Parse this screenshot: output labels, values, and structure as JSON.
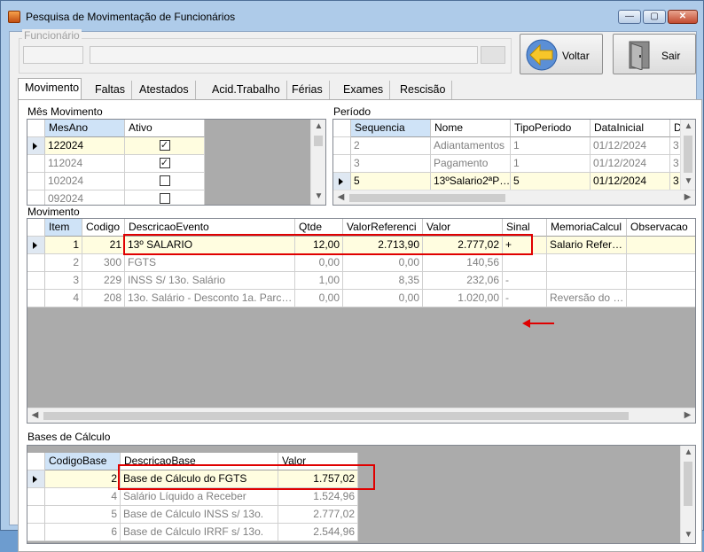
{
  "window": {
    "title": "Pesquisa de Movimentação de Funcionários",
    "minimize": "—",
    "maximize": "▢",
    "close": "✕"
  },
  "funcionario": {
    "legend": "Funcionário"
  },
  "buttons": {
    "voltar": "Voltar",
    "sair": "Sair"
  },
  "tabs": [
    "Movimento",
    "Faltas",
    "Atestados",
    "Acid.Trabalho",
    "Férias",
    "Exames",
    "Rescisão"
  ],
  "mes_movimento": {
    "title": "Mês Movimento",
    "headers": [
      "MesAno",
      "Ativo"
    ],
    "rows": [
      {
        "mesano": "122024",
        "ativo": true
      },
      {
        "mesano": "112024",
        "ativo": true
      },
      {
        "mesano": "102024",
        "ativo": false
      },
      {
        "mesano": "092024",
        "ativo": false
      }
    ]
  },
  "periodo": {
    "title": "Período",
    "headers": [
      "Sequencia",
      "Nome",
      "TipoPeriodo",
      "DataInicial",
      "D"
    ],
    "rows": [
      [
        "2",
        "Adiantamentos",
        "1",
        "01/12/2024",
        "3"
      ],
      [
        "3",
        "Pagamento",
        "1",
        "01/12/2024",
        "3"
      ],
      [
        "5",
        "13ºSalario2ªP…",
        "5",
        "01/12/2024",
        "3"
      ]
    ]
  },
  "movimento": {
    "title": "Movimento",
    "headers": [
      "Item",
      "Codigo",
      "DescricaoEvento",
      "Qtde",
      "ValorReferenci",
      "Valor",
      "Sinal",
      "MemoriaCalcul",
      "Observacao"
    ],
    "rows": [
      [
        "1",
        "21",
        "13º SALARIO",
        "12,00",
        "2.713,90",
        "2.777,02",
        "+",
        "Salario Refer…",
        ""
      ],
      [
        "2",
        "300",
        "FGTS",
        "0,00",
        "0,00",
        "140,56",
        "",
        "",
        ""
      ],
      [
        "3",
        "229",
        "INSS S/ 13o. Salário",
        "1,00",
        "8,35",
        "232,06",
        "-",
        "",
        ""
      ],
      [
        "4",
        "208",
        "13o. Salário - Desconto 1a. Parc…",
        "0,00",
        "0,00",
        "1.020,00",
        "-",
        "Reversão do …",
        ""
      ]
    ]
  },
  "bases": {
    "title": "Bases de Cálculo",
    "headers": [
      "CodigoBase",
      "DescricaoBase",
      "Valor"
    ],
    "rows": [
      [
        "2",
        "Base de Cálculo do FGTS",
        "1.757,02"
      ],
      [
        "4",
        "Salário Líquido a Receber",
        "1.524,96"
      ],
      [
        "5",
        "Base de Cálculo INSS s/ 13o.",
        "2.777,02"
      ],
      [
        "6",
        "Base de Cálculo IRRF s/ 13o.",
        "2.544,96"
      ]
    ]
  },
  "colors": {
    "selected_row": "#fffde0",
    "highlight": "#e00000",
    "grid_empty": "#ababab"
  }
}
